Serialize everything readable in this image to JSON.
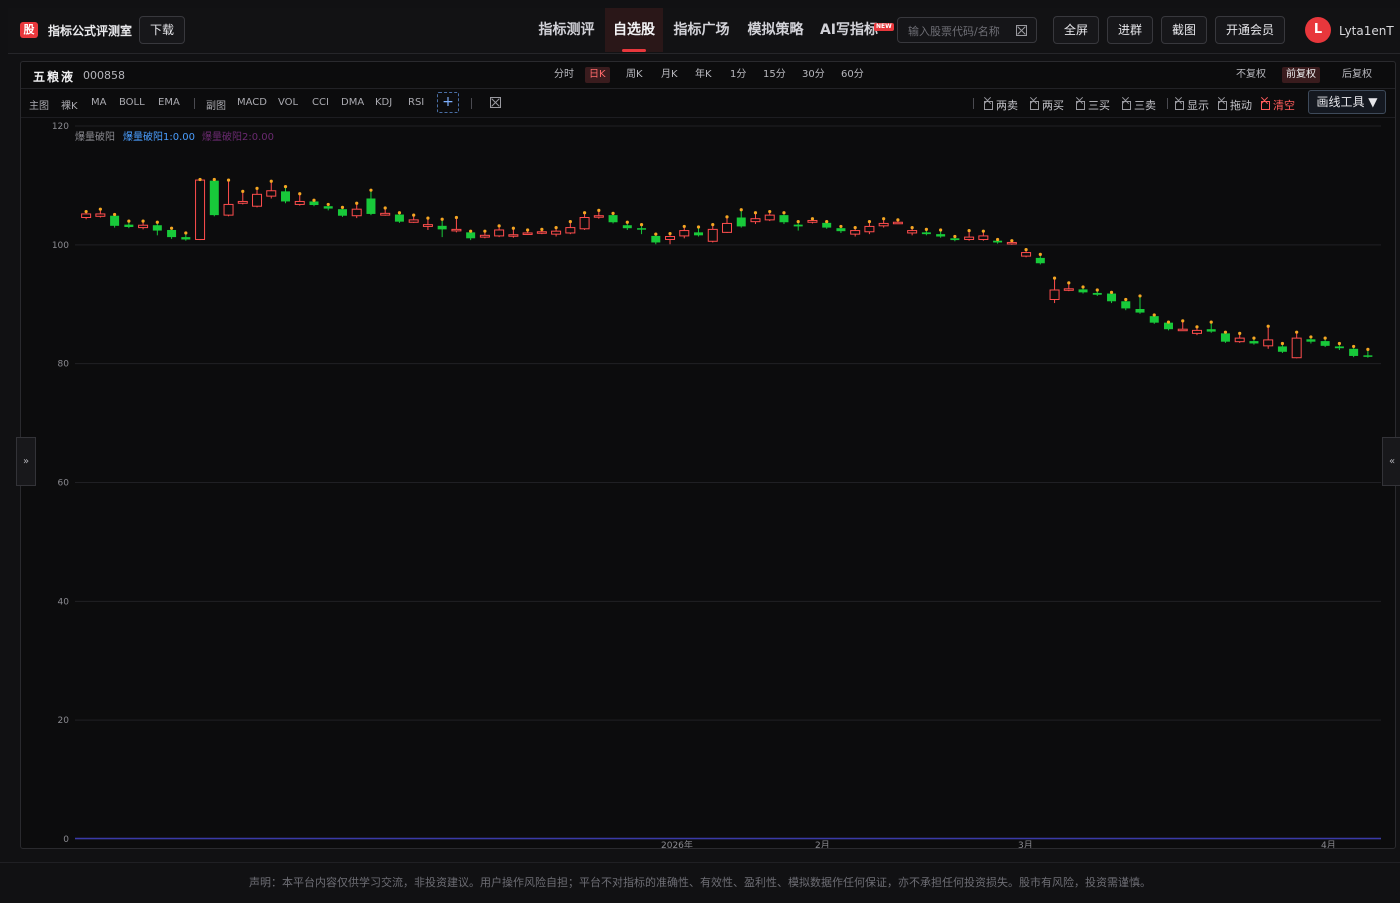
{
  "app": {
    "logo_text": "股",
    "title": "指标公式评测室",
    "download_label": "下载"
  },
  "nav": [
    {
      "label": "指标测评",
      "active": false
    },
    {
      "label": "自选股",
      "active": true
    },
    {
      "label": "指标广场",
      "active": false
    },
    {
      "label": "模拟策略",
      "active": false
    },
    {
      "label": "AI写指标",
      "active": false,
      "badge": "NEW"
    }
  ],
  "search": {
    "placeholder": "输入股票代码/名称"
  },
  "header_buttons": {
    "fullscreen": "全屏",
    "join_group": "进群",
    "screenshot": "截图",
    "membership": "开通会员"
  },
  "user": {
    "avatar_letter": "L",
    "name": "Lyta1enT"
  },
  "stock": {
    "name": "五粮液",
    "code": "000858"
  },
  "timeframes": [
    {
      "label": "分时",
      "active": false
    },
    {
      "label": "日K",
      "active": true
    },
    {
      "label": "周K",
      "active": false
    },
    {
      "label": "月K",
      "active": false
    },
    {
      "label": "年K",
      "active": false
    },
    {
      "label": "1分",
      "active": false
    },
    {
      "label": "15分",
      "active": false
    },
    {
      "label": "30分",
      "active": false
    },
    {
      "label": "60分",
      "active": false
    }
  ],
  "adjust": [
    {
      "label": "不复权",
      "active": false
    },
    {
      "label": "前复权",
      "active": true
    },
    {
      "label": "后复权",
      "active": false
    }
  ],
  "indicators": {
    "main_label": "主图",
    "main": [
      "裸K",
      "MA",
      "BOLL",
      "EMA"
    ],
    "sub_label": "副图",
    "sub": [
      "MACD",
      "VOL",
      "CCI",
      "DMA",
      "KDJ",
      "RSI"
    ],
    "add_symbol": "+"
  },
  "signals": [
    {
      "label": "两卖",
      "red": false
    },
    {
      "label": "两买",
      "red": false
    },
    {
      "label": "三买",
      "red": false
    },
    {
      "label": "三卖",
      "red": false
    },
    {
      "label": "显示",
      "red": false
    },
    {
      "label": "拖动",
      "red": false
    },
    {
      "label": "清空",
      "red": true
    }
  ],
  "draw_tool_label": "画线工具",
  "legend": {
    "name": "爆量破阳",
    "value1": "爆量破阳1:0.00",
    "value2": "爆量破阳2:0.00"
  },
  "side_buttons": {
    "left": "»",
    "right": "«"
  },
  "colors": {
    "up": "#ff4d4d",
    "down": "#18c93a",
    "wick_dot": "#f5a623",
    "accent": "#e8373c",
    "legend_blue": "#4a9eff",
    "legend_purple": "#6a2a70",
    "baseline": "#3a3aa8"
  },
  "chart_data": {
    "type": "candlestick",
    "ylim": [
      0,
      120
    ],
    "yticks": [
      0,
      20,
      40,
      60,
      80,
      100,
      120
    ],
    "x_labels": [
      "2026年",
      "2月",
      "3月",
      "4月"
    ],
    "candles": [
      {
        "o": 104.6,
        "c": 105.2,
        "h": 105.6,
        "l": 104.3
      },
      {
        "o": 104.8,
        "c": 105.2,
        "h": 106.0,
        "l": 104.6
      },
      {
        "o": 104.9,
        "c": 103.2,
        "h": 105.1,
        "l": 102.9
      },
      {
        "o": 103.4,
        "c": 103.0,
        "h": 104.0,
        "l": 102.8
      },
      {
        "o": 102.9,
        "c": 103.3,
        "h": 104.0,
        "l": 102.6
      },
      {
        "o": 103.3,
        "c": 102.4,
        "h": 103.8,
        "l": 101.6
      },
      {
        "o": 102.5,
        "c": 101.3,
        "h": 102.8,
        "l": 101.0
      },
      {
        "o": 101.3,
        "c": 100.9,
        "h": 102.0,
        "l": 100.7
      },
      {
        "o": 100.9,
        "c": 110.9,
        "h": 111.0,
        "l": 100.8
      },
      {
        "o": 110.8,
        "c": 105.0,
        "h": 111.0,
        "l": 104.8
      },
      {
        "o": 105.0,
        "c": 106.8,
        "h": 110.9,
        "l": 104.8
      },
      {
        "o": 107.0,
        "c": 107.3,
        "h": 109.0,
        "l": 106.8
      },
      {
        "o": 106.5,
        "c": 108.5,
        "h": 109.5,
        "l": 106.3
      },
      {
        "o": 108.2,
        "c": 109.1,
        "h": 110.7,
        "l": 107.8
      },
      {
        "o": 109.0,
        "c": 107.3,
        "h": 109.8,
        "l": 107.0
      },
      {
        "o": 106.8,
        "c": 107.3,
        "h": 108.6,
        "l": 106.6
      },
      {
        "o": 107.3,
        "c": 106.7,
        "h": 107.5,
        "l": 106.5
      },
      {
        "o": 106.5,
        "c": 106.1,
        "h": 106.8,
        "l": 105.8
      },
      {
        "o": 106.0,
        "c": 104.9,
        "h": 106.3,
        "l": 104.7
      },
      {
        "o": 104.9,
        "c": 106.0,
        "h": 107.0,
        "l": 104.5
      },
      {
        "o": 107.8,
        "c": 105.2,
        "h": 109.2,
        "l": 105.0
      },
      {
        "o": 105.0,
        "c": 105.3,
        "h": 106.2,
        "l": 104.9
      },
      {
        "o": 105.1,
        "c": 103.9,
        "h": 105.4,
        "l": 103.7
      },
      {
        "o": 103.8,
        "c": 104.2,
        "h": 105.0,
        "l": 103.7
      },
      {
        "o": 103.1,
        "c": 103.4,
        "h": 104.5,
        "l": 102.5
      },
      {
        "o": 103.2,
        "c": 102.6,
        "h": 104.3,
        "l": 101.3
      },
      {
        "o": 102.4,
        "c": 102.6,
        "h": 104.6,
        "l": 102.1
      },
      {
        "o": 102.1,
        "c": 101.1,
        "h": 102.3,
        "l": 100.8
      },
      {
        "o": 101.3,
        "c": 101.6,
        "h": 102.3,
        "l": 101.1
      },
      {
        "o": 101.5,
        "c": 102.5,
        "h": 103.2,
        "l": 101.3
      },
      {
        "o": 101.6,
        "c": 101.7,
        "h": 102.8,
        "l": 101.2
      },
      {
        "o": 101.8,
        "c": 102.0,
        "h": 102.5,
        "l": 101.7
      },
      {
        "o": 102.0,
        "c": 102.2,
        "h": 102.6,
        "l": 101.8
      },
      {
        "o": 101.8,
        "c": 102.3,
        "h": 102.9,
        "l": 101.4
      },
      {
        "o": 102.0,
        "c": 102.9,
        "h": 103.9,
        "l": 101.8
      },
      {
        "o": 102.7,
        "c": 104.6,
        "h": 105.4,
        "l": 102.5
      },
      {
        "o": 104.7,
        "c": 104.9,
        "h": 105.8,
        "l": 104.4
      },
      {
        "o": 105.0,
        "c": 103.8,
        "h": 105.3,
        "l": 103.6
      },
      {
        "o": 103.3,
        "c": 102.8,
        "h": 103.8,
        "l": 102.5
      },
      {
        "o": 102.8,
        "c": 102.6,
        "h": 103.4,
        "l": 101.8
      },
      {
        "o": 101.5,
        "c": 100.4,
        "h": 101.8,
        "l": 100.1
      },
      {
        "o": 100.9,
        "c": 101.4,
        "h": 101.9,
        "l": 100.1
      },
      {
        "o": 101.5,
        "c": 102.4,
        "h": 103.1,
        "l": 101.1
      },
      {
        "o": 102.1,
        "c": 101.6,
        "h": 103.0,
        "l": 101.4
      },
      {
        "o": 100.6,
        "c": 102.6,
        "h": 103.4,
        "l": 100.4
      },
      {
        "o": 102.1,
        "c": 103.6,
        "h": 104.7,
        "l": 102.0
      },
      {
        "o": 104.6,
        "c": 103.1,
        "h": 105.9,
        "l": 102.9
      },
      {
        "o": 103.9,
        "c": 104.4,
        "h": 105.4,
        "l": 103.5
      },
      {
        "o": 104.2,
        "c": 105.0,
        "h": 105.6,
        "l": 104.0
      },
      {
        "o": 105.0,
        "c": 103.8,
        "h": 105.4,
        "l": 103.5
      },
      {
        "o": 103.4,
        "c": 103.1,
        "h": 103.9,
        "l": 102.4
      },
      {
        "o": 103.8,
        "c": 104.1,
        "h": 104.4,
        "l": 103.6
      },
      {
        "o": 103.7,
        "c": 102.9,
        "h": 103.9,
        "l": 102.7
      },
      {
        "o": 102.8,
        "c": 102.3,
        "h": 103.1,
        "l": 102.0
      },
      {
        "o": 101.8,
        "c": 102.4,
        "h": 102.9,
        "l": 101.4
      },
      {
        "o": 102.2,
        "c": 103.1,
        "h": 103.9,
        "l": 101.8
      },
      {
        "o": 103.2,
        "c": 103.6,
        "h": 104.4,
        "l": 102.9
      },
      {
        "o": 103.6,
        "c": 103.8,
        "h": 104.2,
        "l": 103.5
      },
      {
        "o": 102.0,
        "c": 102.4,
        "h": 102.9,
        "l": 101.6
      },
      {
        "o": 102.1,
        "c": 101.8,
        "h": 102.6,
        "l": 101.6
      },
      {
        "o": 101.8,
        "c": 101.4,
        "h": 102.5,
        "l": 101.2
      },
      {
        "o": 101.1,
        "c": 100.8,
        "h": 101.4,
        "l": 100.6
      },
      {
        "o": 100.9,
        "c": 101.3,
        "h": 102.4,
        "l": 100.7
      },
      {
        "o": 100.9,
        "c": 101.5,
        "h": 102.3,
        "l": 100.7
      },
      {
        "o": 100.7,
        "c": 100.4,
        "h": 100.9,
        "l": 100.2
      },
      {
        "o": 100.2,
        "c": 100.4,
        "h": 100.7,
        "l": 100.0
      },
      {
        "o": 98.1,
        "c": 98.7,
        "h": 99.2,
        "l": 97.9
      },
      {
        "o": 97.8,
        "c": 96.9,
        "h": 98.4,
        "l": 96.7
      },
      {
        "o": 90.8,
        "c": 92.4,
        "h": 94.4,
        "l": 90.2
      },
      {
        "o": 92.5,
        "c": 92.6,
        "h": 93.6,
        "l": 92.2
      },
      {
        "o": 92.5,
        "c": 92.0,
        "h": 92.9,
        "l": 91.8
      },
      {
        "o": 91.9,
        "c": 91.6,
        "h": 92.4,
        "l": 91.4
      },
      {
        "o": 91.8,
        "c": 90.5,
        "h": 92.0,
        "l": 90.2
      },
      {
        "o": 90.5,
        "c": 89.3,
        "h": 90.8,
        "l": 89.0
      },
      {
        "o": 89.2,
        "c": 88.6,
        "h": 91.4,
        "l": 88.4
      },
      {
        "o": 88.0,
        "c": 86.9,
        "h": 88.2,
        "l": 86.7
      },
      {
        "o": 86.9,
        "c": 85.8,
        "h": 87.0,
        "l": 85.6
      },
      {
        "o": 85.7,
        "c": 85.8,
        "h": 87.2,
        "l": 85.5
      },
      {
        "o": 85.1,
        "c": 85.6,
        "h": 86.2,
        "l": 84.8
      },
      {
        "o": 85.8,
        "c": 85.4,
        "h": 87.0,
        "l": 85.2
      },
      {
        "o": 85.1,
        "c": 83.7,
        "h": 85.3,
        "l": 83.5
      },
      {
        "o": 83.7,
        "c": 84.3,
        "h": 85.1,
        "l": 83.5
      },
      {
        "o": 83.8,
        "c": 83.4,
        "h": 84.3,
        "l": 83.2
      },
      {
        "o": 83.0,
        "c": 84.0,
        "h": 86.3,
        "l": 82.5
      },
      {
        "o": 82.9,
        "c": 82.0,
        "h": 83.4,
        "l": 81.8
      },
      {
        "o": 81.0,
        "c": 84.3,
        "h": 85.3,
        "l": 80.9
      },
      {
        "o": 84.1,
        "c": 83.7,
        "h": 84.5,
        "l": 83.4
      },
      {
        "o": 83.8,
        "c": 83.0,
        "h": 84.3,
        "l": 82.8
      },
      {
        "o": 82.9,
        "c": 82.6,
        "h": 83.4,
        "l": 82.3
      },
      {
        "o": 82.5,
        "c": 81.3,
        "h": 82.9,
        "l": 81.1
      },
      {
        "o": 81.4,
        "c": 81.2,
        "h": 82.4,
        "l": 81.0
      }
    ]
  },
  "disclaimer": "声明：本平台内容仅供学习交流，非投资建议。用户操作风险自担；平台不对指标的准确性、有效性、盈利性、模拟数据作任何保证，亦不承担任何投资损失。股市有风险，投资需谨慎。"
}
